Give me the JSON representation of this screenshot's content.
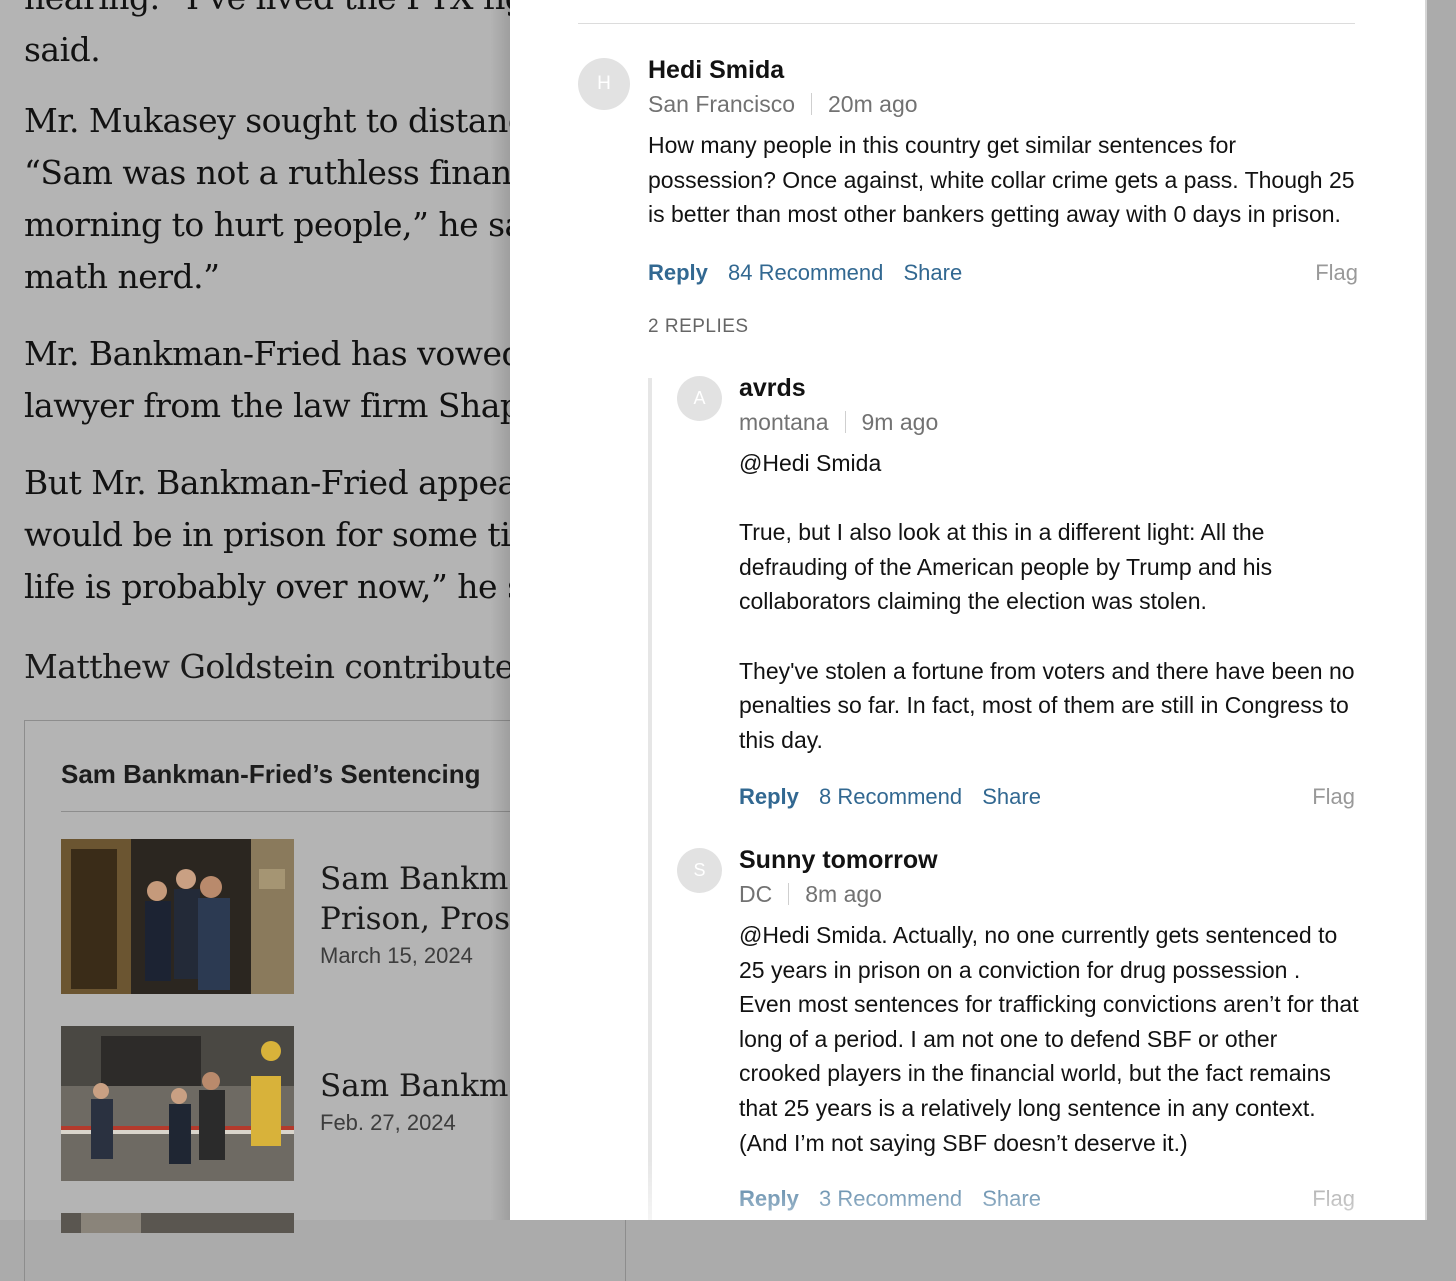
{
  "article": {
    "p0": "hearing. “I’ve lived the PTR fig… said.",
    "p0_line1": "hearing. “I’ve lived the FTX fig",
    "p0_line2": "said.",
    "p1_lines": [
      "Mr. Mukasey sought to distance",
      "“Sam was not a ruthless financi",
      "morning to hurt people,” he said",
      "math nerd.”"
    ],
    "p2_lines": [
      "Mr. Bankman-Fried has vowed t",
      "lawyer from the law firm Shapir"
    ],
    "p3_lines": [
      "But Mr. Bankman-Fried appear",
      "would be in prison for some tim",
      "life is probably over now,” he sai"
    ],
    "credit": "Matthew Goldstein contributed reporting."
  },
  "related": {
    "title": "Sam Bankman-Fried’s Sentencing",
    "items": [
      {
        "headline_lines": [
          "Sam Bankman",
          "Prison, Prosec"
        ],
        "date": "March 15, 2024"
      },
      {
        "headline_lines": [
          "Sam Bankman"
        ],
        "date": "Feb. 27, 2024"
      }
    ]
  },
  "comments": {
    "main": {
      "avatar": "H",
      "author": "Hedi Smida",
      "location": "San Francisco",
      "time": "20m ago",
      "body": [
        "How many people in this country get similar sentences for possession? Once against, white collar crime gets a pass. Though 25 is better than most other bankers getting away with 0 days in prison."
      ],
      "reply_label": "Reply",
      "recommend_label": "84 Recommend",
      "share_label": "Share",
      "flag_label": "Flag"
    },
    "replies_count": "2 REPLIES",
    "replies": [
      {
        "avatar": "A",
        "author": "avrds",
        "location": "montana",
        "time": "9m ago",
        "body": [
          "@Hedi Smida",
          "",
          "True, but I also look at this in a different light:  All the defrauding of the American people by Trump and his collaborators claiming the election was stolen.",
          "",
          "They've stolen a fortune from voters and there have been no penalties so far.  In fact, most of them are still in Congress to this day."
        ],
        "reply_label": "Reply",
        "recommend_label": "8 Recommend",
        "share_label": "Share",
        "flag_label": "Flag"
      },
      {
        "avatar": "S",
        "author": "Sunny tomorrow",
        "location": "DC",
        "time": "8m ago",
        "body": [
          "@Hedi Smida. Actually, no one currently gets sentenced to 25 years in prison on a conviction for  drug possession . Even most sentences for trafficking convictions aren’t for that long of a period. I am not one to defend SBF or other crooked players in the financial world, but the fact remains that 25 years is a relatively long sentence in any context. (And I’m not saying SBF doesn’t deserve it.)"
        ],
        "reply_label": "Reply",
        "recommend_label": "3 Recommend",
        "share_label": "Share",
        "flag_label": "Flag"
      }
    ]
  }
}
